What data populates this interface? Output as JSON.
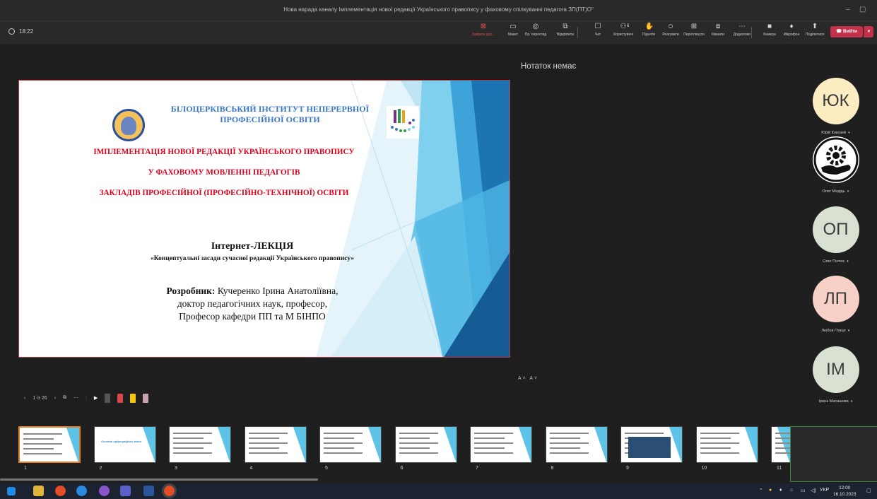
{
  "window": {
    "title": "Нова нарада каналу Імплементація нової редакції Українського правопису у фаховому спілкуванні педагога ЗП(ПТ)О\"",
    "minimize_glyph": "–",
    "maximize_glyph": "▢"
  },
  "meeting": {
    "elapsed": "18:22",
    "toolbar": [
      {
        "label": "Закрити дос...",
        "icon": "close-share-icon",
        "glyph": "⊠",
        "color": "#e04c4c"
      },
      {
        "label": "Макет",
        "icon": "layout-icon",
        "glyph": "▭"
      },
      {
        "label": "Пр. перегляд",
        "icon": "eye-icon",
        "glyph": "◎"
      },
      {
        "label": "Відкріпити",
        "icon": "pop-out-icon",
        "glyph": "⧉"
      },
      {
        "label": "Чат",
        "icon": "chat-icon",
        "glyph": "☐"
      },
      {
        "label": "Користувачі",
        "icon": "people-icon",
        "glyph": "⚇"
      },
      {
        "label": "Підняти",
        "icon": "raise-hand-icon",
        "glyph": "✋"
      },
      {
        "label": "Реагувати",
        "icon": "react-icon",
        "glyph": "☺"
      },
      {
        "label": "Переглянути",
        "icon": "view-icon",
        "glyph": "⊞"
      },
      {
        "label": "Кімнати",
        "icon": "rooms-icon",
        "glyph": "⧈"
      },
      {
        "label": "Додатково",
        "icon": "more-icon",
        "glyph": "⋯"
      },
      {
        "label": "Камера",
        "icon": "camera-icon",
        "glyph": "■"
      },
      {
        "label": "Мікрофон",
        "icon": "microphone-icon",
        "glyph": "♦"
      },
      {
        "label": "Поділитися",
        "icon": "share-icon",
        "glyph": "⬆"
      }
    ],
    "people_count": "6",
    "leave_label": "Вийти",
    "leave_color": "#c4314b"
  },
  "slide": {
    "institute": "БІЛОЦЕРКІВСЬКИЙ ІНСТИТУТ НЕПЕРЕРВНОЇ ПРОФЕСІЙНОЇ ОСВІТИ",
    "title_lines": [
      "ІМПЛЕМЕНТАЦІЯ НОВОЇ РЕДАКЦІЇ УКРАЇНСЬКОГО ПРАВОПИСУ",
      "У ФАХОВОМУ МОВЛЕННІ ПЕДАГОГІВ",
      "ЗАКЛАДІВ ПРОФЕСІЙНОЇ (ПРОФЕСІЙНО-ТЕХНІЧНОЇ) ОСВІТИ"
    ],
    "lecture": "Інтернет-ЛЕКЦІЯ",
    "topic": "«Концептуальні засади сучасної редакції Українського правопису»",
    "author_label": "Розробник:",
    "author_name": " Кучеренко Ірина Анатоліївна,",
    "author_lines": [
      "доктор педагогічних наук, професор,",
      "Професор кафедри ПП та М БІНПО"
    ],
    "accent_color": "#e0001b",
    "blue_color": "#3a76c4"
  },
  "notes": {
    "empty_text": "Нотаток немає",
    "font_controls": "A˄ A˅"
  },
  "participants": [
    {
      "initials": "ЮК",
      "name": "Юрій Кокозей",
      "bg": "#fbecc2"
    },
    {
      "initials": "",
      "name": "Олег Медідь",
      "bg": "#ffffff",
      "icon": "gear-hand-icon"
    },
    {
      "initials": "ОП",
      "name": "Олег Полюх",
      "bg": "#d9e1d3"
    },
    {
      "initials": "ЛП",
      "name": "Любов Птиця",
      "bg": "#f7d0c8"
    },
    {
      "initials": "ІМ",
      "name": "Ірина Масашова",
      "bg": "#d9e1d3"
    }
  ],
  "slide_nav": {
    "counter": "1 із 26",
    "prev": "‹",
    "next": "›"
  },
  "thumbnails": {
    "numbers": [
      "1",
      "2",
      "3",
      "4",
      "5",
      "6",
      "7",
      "8",
      "9",
      "10",
      "11"
    ],
    "captions": [
      "",
      "Основні орфографічні зміни",
      "",
      "",
      "",
      "",
      "",
      "",
      "",
      "",
      ""
    ]
  },
  "taskbar": {
    "language": "УКР",
    "time": "12:00",
    "date": "16.10.2023"
  }
}
